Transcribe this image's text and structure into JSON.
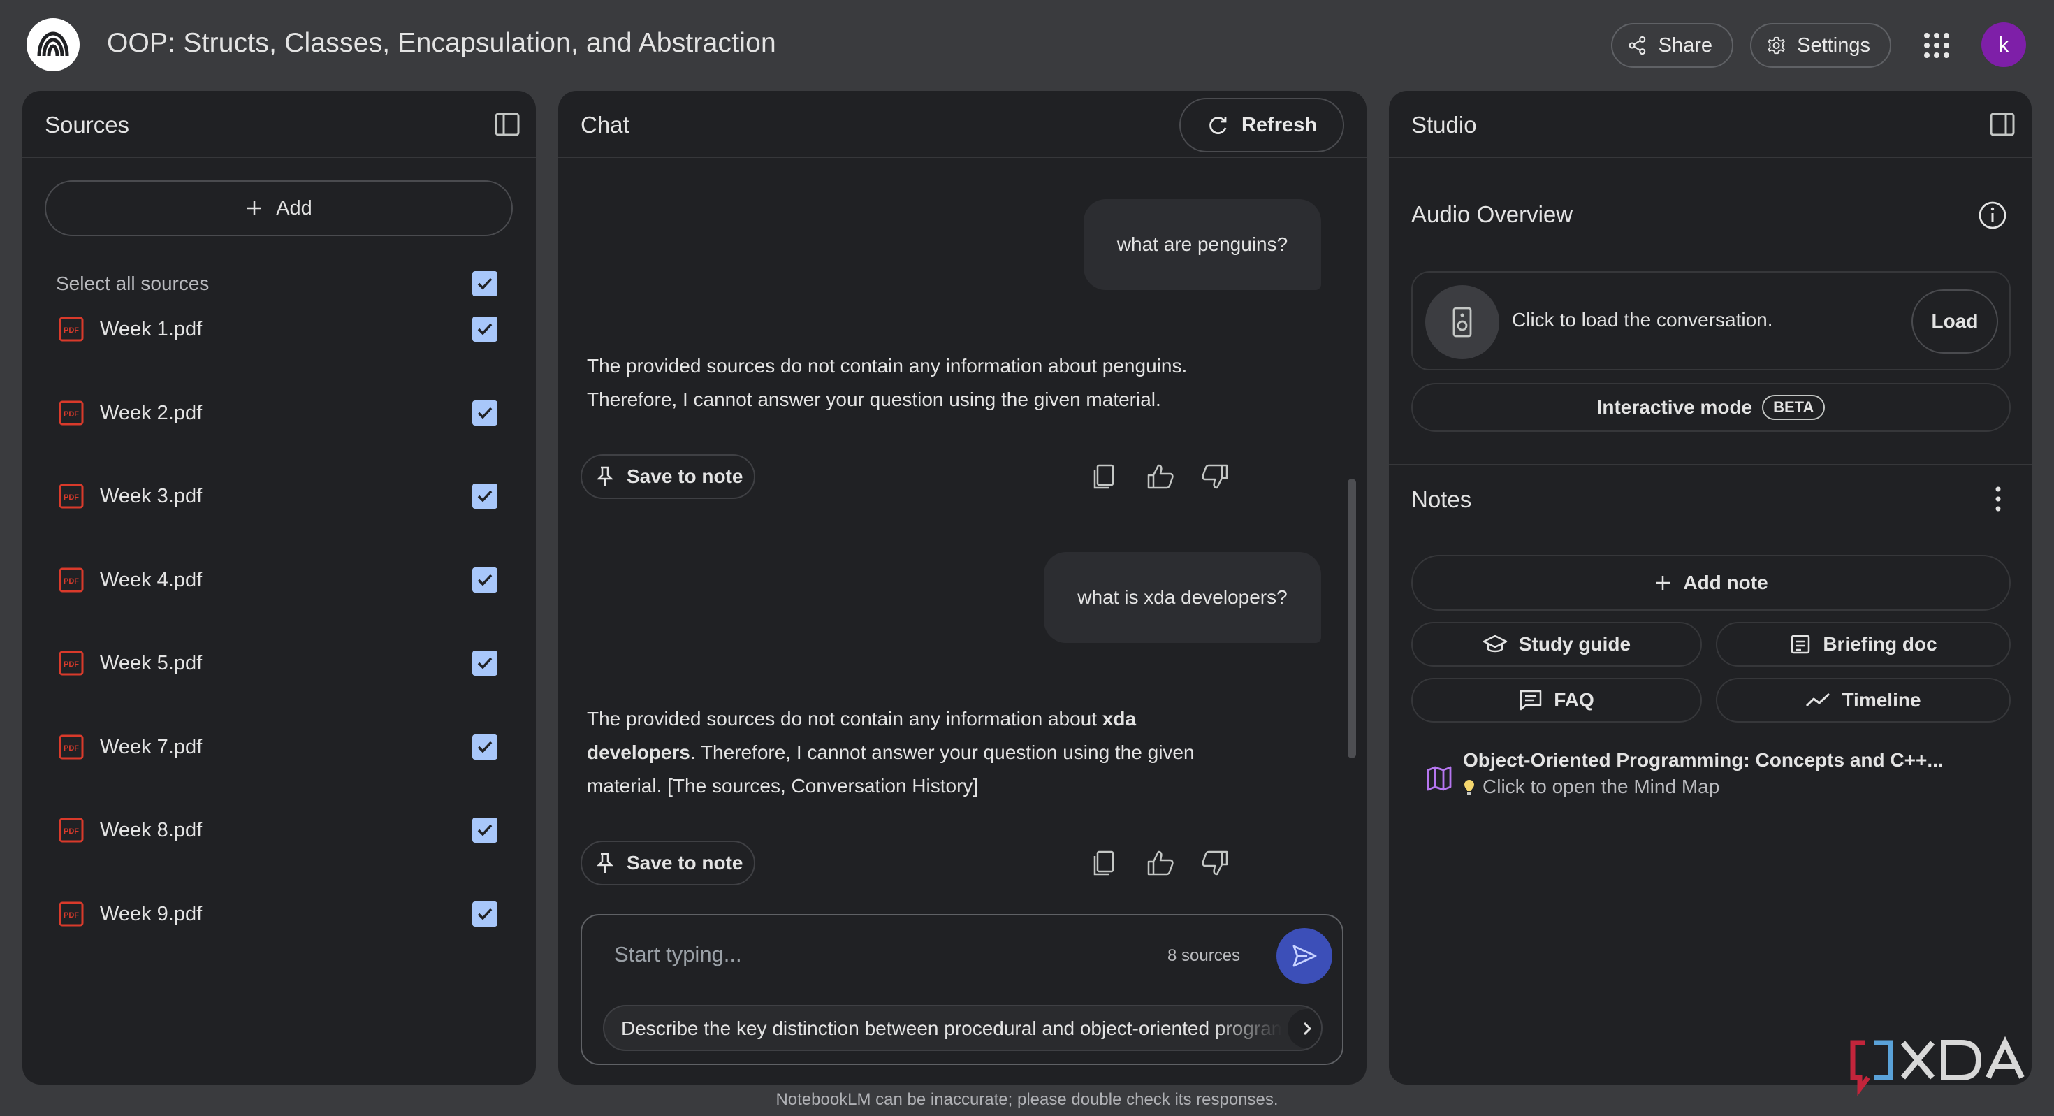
{
  "header": {
    "notebook_title": "OOP: Structs, Classes, Encapsulation, and Abstraction",
    "share_label": "Share",
    "settings_label": "Settings",
    "avatar_initial": "k"
  },
  "sources": {
    "title": "Sources",
    "add_label": "Add",
    "select_all_label": "Select all sources",
    "items": [
      {
        "name": "Week 1.pdf",
        "checked": true
      },
      {
        "name": "Week 2.pdf",
        "checked": true
      },
      {
        "name": "Week 3.pdf",
        "checked": true
      },
      {
        "name": "Week 4.pdf",
        "checked": true
      },
      {
        "name": "Week 5.pdf",
        "checked": true
      },
      {
        "name": "Week 7.pdf",
        "checked": true
      },
      {
        "name": "Week 8.pdf",
        "checked": true
      },
      {
        "name": "Week 9.pdf",
        "checked": true
      }
    ]
  },
  "chat": {
    "title": "Chat",
    "refresh_label": "Refresh",
    "messages": [
      {
        "role": "user",
        "text": "what are penguins?"
      },
      {
        "role": "assistant",
        "lines": [
          "The provided sources do not contain any information about penguins.",
          "Therefore, I cannot answer your question using the given material."
        ]
      },
      {
        "role": "user",
        "text": "what is xda developers?"
      },
      {
        "role": "assistant",
        "parts": {
          "a": "The provided sources do not contain any information about ",
          "b": "xda",
          "c": "developers",
          "d": ". Therefore, I cannot answer your question using the given",
          "e": "material. [The sources, Conversation History]"
        }
      }
    ],
    "save_note_label": "Save to note",
    "composer_placeholder": "Start typing...",
    "sources_count": "8 sources",
    "suggestion": "Describe the key distinction between procedural and object-oriented programming."
  },
  "studio": {
    "title": "Studio",
    "audio_overview_title": "Audio Overview",
    "audio_card_text": "Click to load the conversation.",
    "load_label": "Load",
    "interactive_label": "Interactive mode",
    "beta_label": "BETA",
    "notes_title": "Notes",
    "add_note_label": "Add note",
    "buttons": {
      "study_guide": "Study guide",
      "briefing_doc": "Briefing doc",
      "faq": "FAQ",
      "timeline": "Timeline"
    },
    "mindmap_title": "Object-Oriented Programming: Concepts and C++...",
    "mindmap_sub": "Click to open the Mind Map"
  },
  "footer": "NotebookLM can be inaccurate; please double check its responses.",
  "watermark": "XDA",
  "colors": {
    "background": "#3a3b3e",
    "panel": "#202124",
    "checkbox": "#a8c7fa",
    "pdf_red": "#d93a2b",
    "avatar": "#7e1fa8",
    "send": "#3c4fb8",
    "mindmap_purple": "#b676f0"
  }
}
